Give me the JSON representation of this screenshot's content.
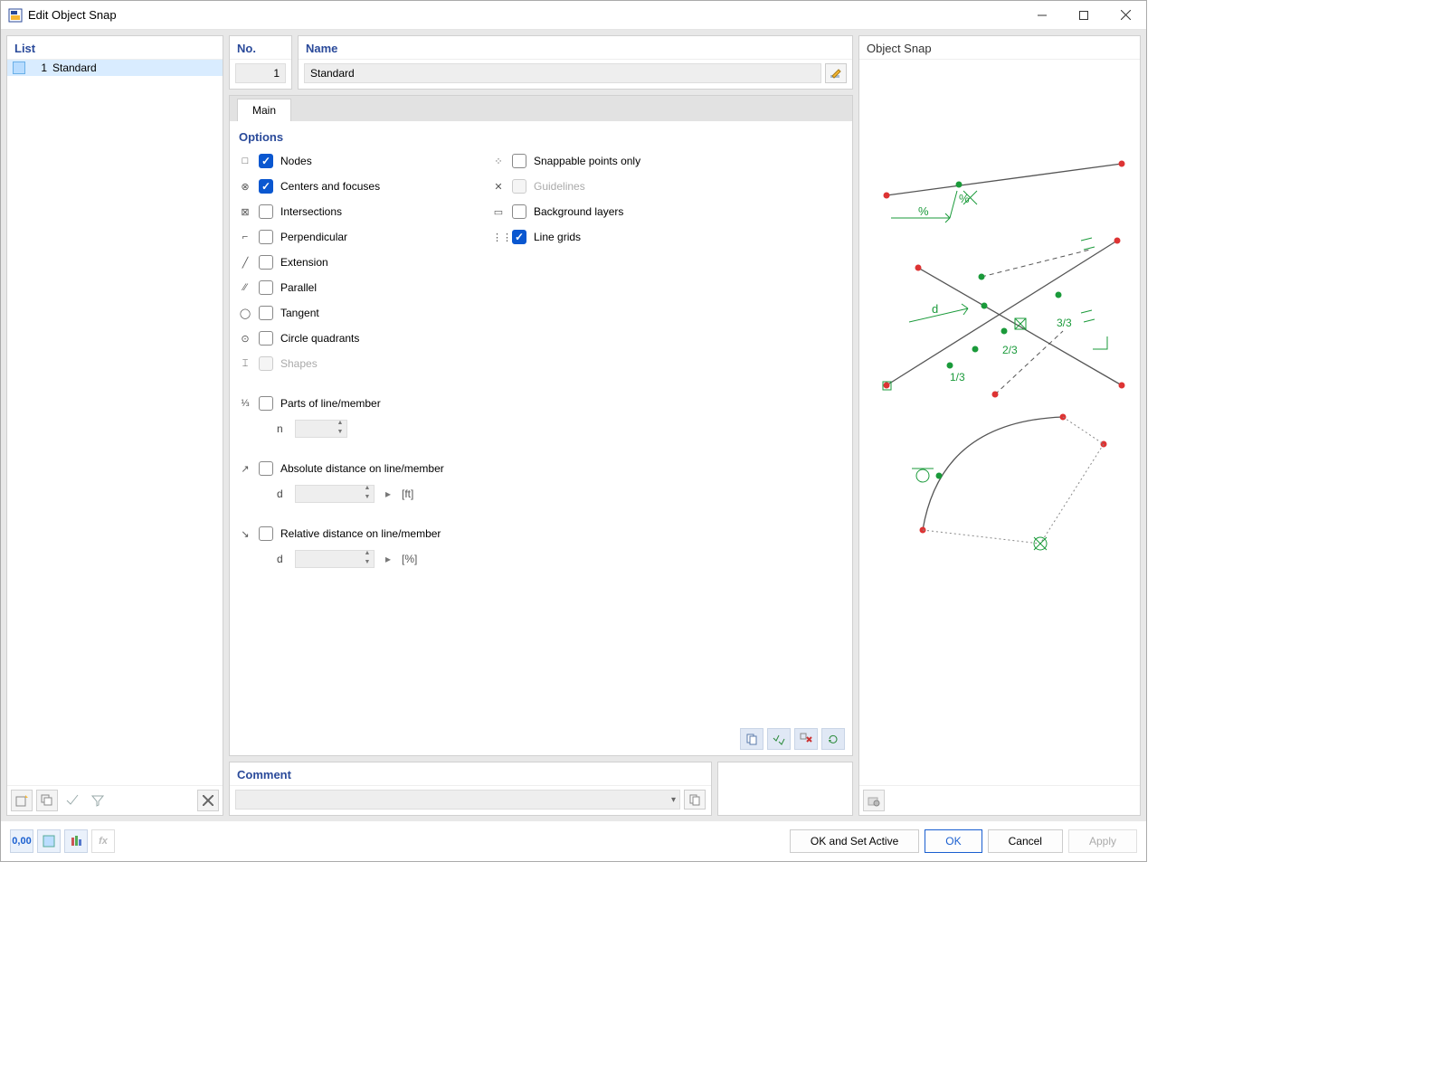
{
  "window": {
    "title": "Edit Object Snap"
  },
  "list": {
    "header": "List",
    "items": [
      {
        "index": "1",
        "name": "Standard"
      }
    ]
  },
  "no_panel": {
    "header": "No.",
    "value": "1"
  },
  "name_panel": {
    "header": "Name",
    "value": "Standard"
  },
  "tabs": {
    "main": "Main"
  },
  "options": {
    "header": "Options",
    "left": [
      {
        "glyph": "□",
        "label": "Nodes",
        "checked": true
      },
      {
        "glyph": "⊗",
        "label": "Centers and focuses",
        "checked": true
      },
      {
        "glyph": "⊠",
        "label": "Intersections",
        "checked": false
      },
      {
        "glyph": "⌐",
        "label": "Perpendicular",
        "checked": false
      },
      {
        "glyph": "╱",
        "label": "Extension",
        "checked": false
      },
      {
        "glyph": "⁄⁄",
        "label": "Parallel",
        "checked": false
      },
      {
        "glyph": "◯",
        "label": "Tangent",
        "checked": false
      },
      {
        "glyph": "⊙",
        "label": "Circle quadrants",
        "checked": false
      },
      {
        "glyph": "⌶",
        "label": "Shapes",
        "checked": false,
        "disabled": true
      }
    ],
    "right": [
      {
        "glyph": "⁘",
        "label": "Snappable points only",
        "checked": false
      },
      {
        "glyph": "✕",
        "label": "Guidelines",
        "checked": false,
        "disabled": true
      },
      {
        "glyph": "▭",
        "label": "Background layers",
        "checked": false
      },
      {
        "glyph": "⋮⋮",
        "label": "Line grids",
        "checked": true
      }
    ],
    "parts": {
      "glyph": "⅓",
      "label": "Parts of line/member",
      "checked": false,
      "sub_label": "n",
      "value": ""
    },
    "abs_dist": {
      "glyph": "↗",
      "label": "Absolute distance on line/member",
      "checked": false,
      "sub_label": "d",
      "value": "",
      "unit": "[ft]"
    },
    "rel_dist": {
      "glyph": "↘",
      "label": "Relative distance on line/member",
      "checked": false,
      "sub_label": "d",
      "value": "",
      "unit": "[%]"
    }
  },
  "comment": {
    "header": "Comment",
    "value": ""
  },
  "preview": {
    "header": "Object Snap",
    "labels": {
      "pct1": "%",
      "pct2": "%",
      "d": "d",
      "f13": "1/3",
      "f23": "2/3",
      "f33": "3/3"
    }
  },
  "buttons": {
    "ok_set_active": "OK and Set Active",
    "ok": "OK",
    "cancel": "Cancel",
    "apply": "Apply"
  }
}
